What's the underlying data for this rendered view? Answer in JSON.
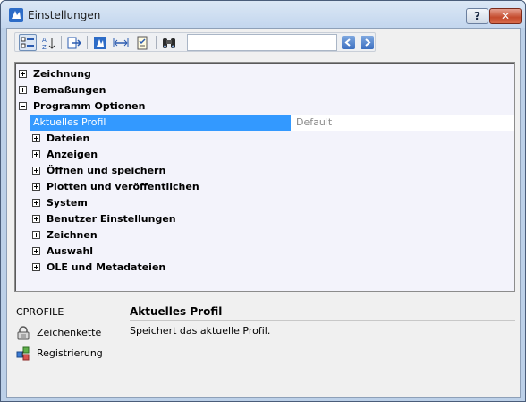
{
  "window": {
    "title": "Einstellungen",
    "help_label": "?",
    "close_label": "✕"
  },
  "toolbar": {
    "buttons": [
      {
        "icon": "categorized-view-icon",
        "active": true
      },
      {
        "icon": "sort-alphabetical-icon",
        "active": false
      },
      {
        "icon": "export-icon",
        "active": false
      },
      {
        "icon": "drawing-settings-icon",
        "active": false
      },
      {
        "icon": "dimension-settings-icon",
        "active": false
      },
      {
        "icon": "checklist-icon",
        "active": false
      },
      {
        "icon": "binoculars-icon",
        "active": false
      }
    ],
    "search_value": "",
    "nav_back_icon": "arrow-left-icon",
    "nav_forward_icon": "arrow-right-icon"
  },
  "tree": {
    "top_items": [
      {
        "label": "Zeichnung",
        "state": "collapsed"
      },
      {
        "label": "Bemaßungen",
        "state": "collapsed"
      },
      {
        "label": "Programm Optionen",
        "state": "expanded"
      }
    ],
    "selected": {
      "label": "Aktuelles Profil",
      "value": "Default"
    },
    "children": [
      {
        "label": "Dateien"
      },
      {
        "label": "Anzeigen"
      },
      {
        "label": "Öffnen und speichern"
      },
      {
        "label": "Plotten und veröffentlichen"
      },
      {
        "label": "System"
      },
      {
        "label": "Benutzer Einstellungen"
      },
      {
        "label": "Zeichnen"
      },
      {
        "label": "Auswahl"
      },
      {
        "label": "OLE und Metadateien"
      }
    ]
  },
  "info": {
    "variable": "CPROFILE",
    "type_label": "Zeichenkette",
    "type_icon": "lock-icon",
    "storage_label": "Registrierung",
    "storage_icon": "registry-icon",
    "title": "Aktuelles Profil",
    "description": "Speichert das aktuelle Profil."
  },
  "colors": {
    "selection": "#3399ff",
    "tree_background": "#f3f3fb",
    "window_frame": "#bcd0e8"
  }
}
